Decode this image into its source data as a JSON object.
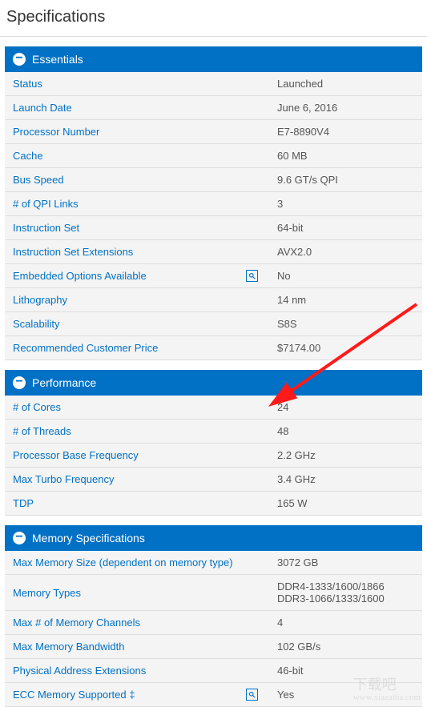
{
  "page_title": "Specifications",
  "sections": [
    {
      "title": "Essentials",
      "rows": [
        {
          "label": "Status",
          "value": "Launched",
          "info": false
        },
        {
          "label": "Launch Date",
          "value": "June 6, 2016",
          "info": false
        },
        {
          "label": "Processor Number",
          "value": "E7-8890V4",
          "info": false
        },
        {
          "label": "Cache",
          "value": "60 MB",
          "info": false
        },
        {
          "label": "Bus Speed",
          "value": "9.6 GT/s QPI",
          "info": false
        },
        {
          "label": "# of QPI Links",
          "value": "3",
          "info": false
        },
        {
          "label": "Instruction Set",
          "value": "64-bit",
          "info": false
        },
        {
          "label": "Instruction Set Extensions",
          "value": "AVX2.0",
          "info": false
        },
        {
          "label": "Embedded Options Available",
          "value": "No",
          "info": true
        },
        {
          "label": "Lithography",
          "value": "14 nm",
          "info": false
        },
        {
          "label": "Scalability",
          "value": "S8S",
          "info": false
        },
        {
          "label": "Recommended Customer Price",
          "value": "$7174.00",
          "info": false
        }
      ]
    },
    {
      "title": "Performance",
      "rows": [
        {
          "label": "# of Cores",
          "value": "24",
          "info": false
        },
        {
          "label": "# of Threads",
          "value": "48",
          "info": false
        },
        {
          "label": "Processor Base Frequency",
          "value": "2.2 GHz",
          "info": false
        },
        {
          "label": "Max Turbo Frequency",
          "value": "3.4 GHz",
          "info": false
        },
        {
          "label": "TDP",
          "value": "165 W",
          "info": false
        }
      ]
    },
    {
      "title": "Memory Specifications",
      "rows": [
        {
          "label": "Max Memory Size (dependent on memory type)",
          "value": "3072 GB",
          "info": false
        },
        {
          "label": "Memory Types",
          "value": "DDR4-1333/1600/1866 DDR3-1066/1333/1600",
          "info": false
        },
        {
          "label": "Max # of Memory Channels",
          "value": "4",
          "info": false
        },
        {
          "label": "Max Memory Bandwidth",
          "value": "102 GB/s",
          "info": false
        },
        {
          "label": "Physical Address Extensions",
          "value": "46-bit",
          "info": false
        },
        {
          "label": "ECC Memory Supported ‡",
          "value": "Yes",
          "info": true
        }
      ]
    }
  ],
  "watermark": {
    "main": "下载吧",
    "sub": "www.xiazaiba.com"
  }
}
